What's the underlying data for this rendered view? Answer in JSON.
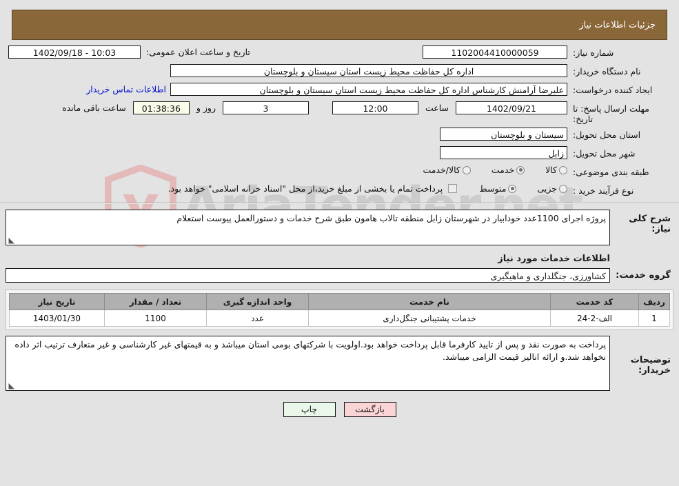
{
  "header": {
    "title": "جزئیات اطلاعات نیاز"
  },
  "form": {
    "need_number_label": "شماره نیاز:",
    "need_number_value": "1102004410000059",
    "announce_label": "تاریخ و ساعت اعلان عمومی:",
    "announce_value": "1402/09/18 - 10:03",
    "buyer_org_label": "نام دستگاه خریدار:",
    "buyer_org_value": "اداره کل حفاظت محیط زیست استان سیستان و بلوچستان",
    "creator_label": "ایجاد کننده درخواست:",
    "creator_value": "علیرضا آرامنش کارشناس اداره کل حفاظت محیط زیست استان سیستان و بلوچستان",
    "contact_link": "اطلاعات تماس خریدار",
    "deadline_label": "مهلت ارسال پاسخ: تا تاریخ:",
    "deadline_date": "1402/09/21",
    "hour_label": "ساعت",
    "hour_value": "12:00",
    "days_value": "3",
    "days_and_label": "روز و",
    "countdown_value": "01:38:36",
    "remaining_label": "ساعت باقی مانده",
    "province_label": "استان محل تحویل:",
    "province_value": "سیستان و بلوچستان",
    "city_label": "شهر محل تحویل:",
    "city_value": "زابل",
    "category_label": "طبقه بندی موضوعی:",
    "category_options": [
      {
        "label": "کالا",
        "selected": false
      },
      {
        "label": "خدمت",
        "selected": true
      },
      {
        "label": "کالا/خدمت",
        "selected": false
      }
    ],
    "process_label": "نوع فرآیند خرید :",
    "process_options": [
      {
        "label": "جزیی",
        "selected": false
      },
      {
        "label": "متوسط",
        "selected": true
      }
    ],
    "treasury_checkbox_label": "پرداخت تمام یا بخشی از مبلغ خرید،از محل \"اسناد خزانه اسلامی\" خواهد بود.",
    "treasury_checked": false
  },
  "description": {
    "need_summary_label": "شرح کلی نیاز:",
    "need_summary_value": "پروژه اجرای 1100عدد خودابیار در شهرستان زابل منطقه تالاب هامون طبق شرح خدمات و دستورالعمل پیوست استعلام",
    "services_section_title": "اطلاعات خدمات مورد نیاز",
    "service_group_label": "گروه خدمت:",
    "service_group_value": "کشاورزی، جنگلداری و ماهیگیری"
  },
  "table": {
    "headers": [
      "ردیف",
      "کد خدمت",
      "نام خدمت",
      "واحد اندازه گیری",
      "تعداد / مقدار",
      "تاریخ نیاز"
    ],
    "rows": [
      {
        "row_no": "1",
        "service_code": "الف-2-24",
        "service_name": "خدمات پشتیبانی جنگل‌داری",
        "unit": "عدد",
        "quantity": "1100",
        "need_date": "1403/01/30"
      }
    ]
  },
  "notes": {
    "label": "توضیحات خریدار:",
    "value": "پرداخت به صورت نقد و پس از تایید کارفرما قابل پرداخت خواهد بود.اولویت با شرکتهای بومی استان میباشد و به قیمتهای غیر کارشناسی و غیر متعارف ترتیب اثر داده نخواهد شد.و ارائه انالیز قیمت الزامی میباشد."
  },
  "footer": {
    "print_label": "چاپ",
    "back_label": "بازگشت"
  },
  "watermark": {
    "text_main": "AriaTender",
    "text_suffix": ".net"
  },
  "colors": {
    "header_bg": "#8a6739",
    "link": "#0011cc",
    "print_btn": "#e9f8e9",
    "back_btn": "#fbd5d5",
    "table_header": "#b0b0b0",
    "countdown_bg": "#fbfbe9"
  }
}
